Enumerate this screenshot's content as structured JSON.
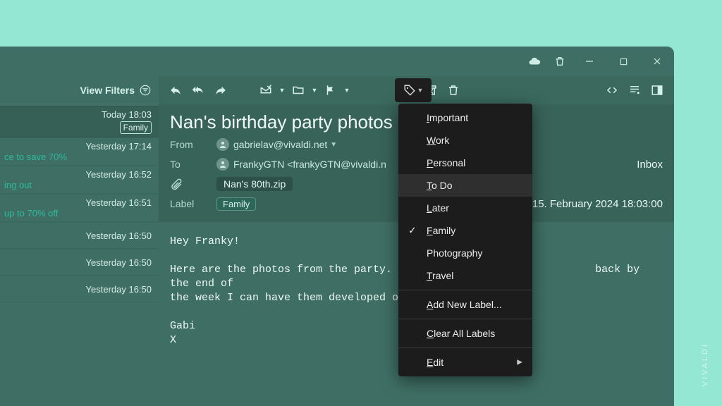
{
  "brand": "VIVALDI",
  "sidebar": {
    "view_filters_label": "View Filters",
    "items": [
      {
        "date": "Today 18:03",
        "tag": "Family",
        "snippet": "",
        "selected": true
      },
      {
        "date": "Yesterday 17:14",
        "tag": "",
        "snippet": "ce to save 70%"
      },
      {
        "date": "Yesterday 16:52",
        "tag": "",
        "snippet": "ing out"
      },
      {
        "date": "Yesterday 16:51",
        "tag": "",
        "snippet": "up to 70% off"
      },
      {
        "date": "Yesterday 16:50",
        "tag": "",
        "snippet": ""
      },
      {
        "date": "Yesterday 16:50",
        "tag": "",
        "snippet": ""
      },
      {
        "date": "Yesterday 16:50",
        "tag": "",
        "snippet": ""
      }
    ]
  },
  "message": {
    "subject": "Nan's birthday party photos",
    "from_label": "From",
    "from": "gabrielav@vivaldi.net",
    "to_label": "To",
    "to": "FrankyGTN <frankyGTN@vivaldi.n",
    "attachment": "Nan's 80th.zip",
    "label_label": "Label",
    "label": "Family",
    "folder": "Inbox",
    "date": "15. February 2024 18:03:00",
    "body_line1": "Hey Franky!",
    "body_line2": "Here are the photos from the party. If",
    "body_line2b": "back by the end of",
    "body_line3": "the week I can have them developed on",
    "body_sign1": "Gabi",
    "body_sign2": "X"
  },
  "labels_menu": {
    "items": [
      {
        "label": "Important",
        "u": "I"
      },
      {
        "label": "Work",
        "u": "W"
      },
      {
        "label": "Personal",
        "u": "P"
      },
      {
        "label": "To Do",
        "u": "T",
        "highlight": true
      },
      {
        "label": "Later",
        "u": "L"
      },
      {
        "label": "Family",
        "u": "F",
        "checked": true
      },
      {
        "label": "Photography"
      },
      {
        "label": "Travel",
        "u": "T"
      }
    ],
    "add_new": "Add New Label...",
    "clear_all": "Clear All Labels",
    "edit": "Edit"
  }
}
